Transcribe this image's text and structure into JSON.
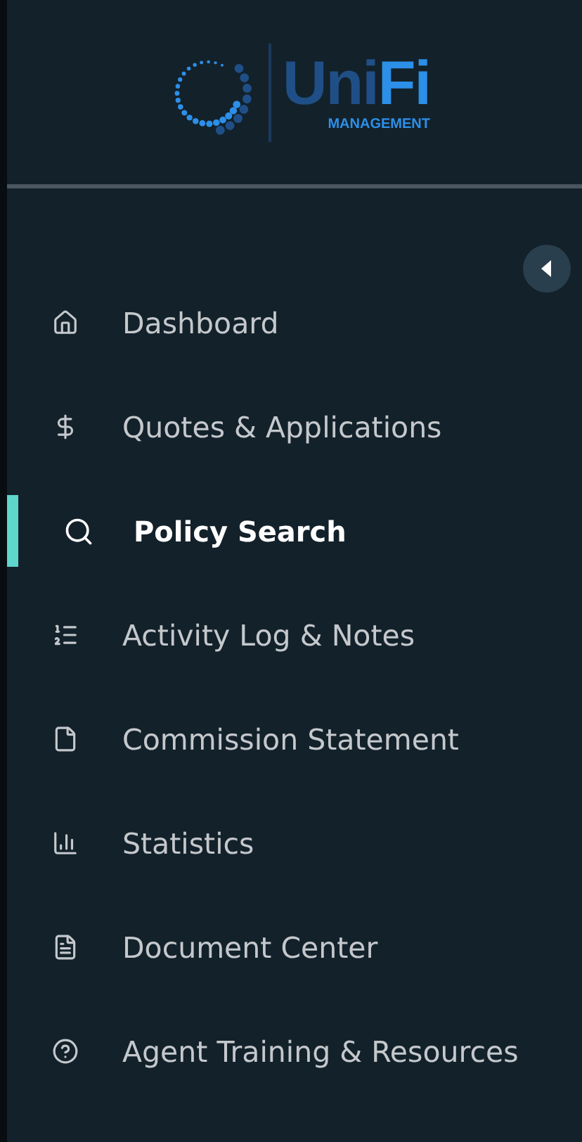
{
  "logo": {
    "name_dim": "Uni",
    "name_bright": "Fi",
    "tagline": "MANAGEMENT"
  },
  "collapse_button": {
    "expanded": true
  },
  "nav": [
    {
      "label": "Dashboard",
      "selected": false
    },
    {
      "label": "Quotes & Applications",
      "selected": false
    },
    {
      "label": "Policy Search",
      "selected": true
    },
    {
      "label": "Activity Log & Notes",
      "selected": false
    },
    {
      "label": "Commission Statement",
      "selected": false
    },
    {
      "label": "Statistics",
      "selected": false
    },
    {
      "label": "Document Center",
      "selected": false
    },
    {
      "label": "Agent Training & Resources",
      "selected": false
    }
  ]
}
